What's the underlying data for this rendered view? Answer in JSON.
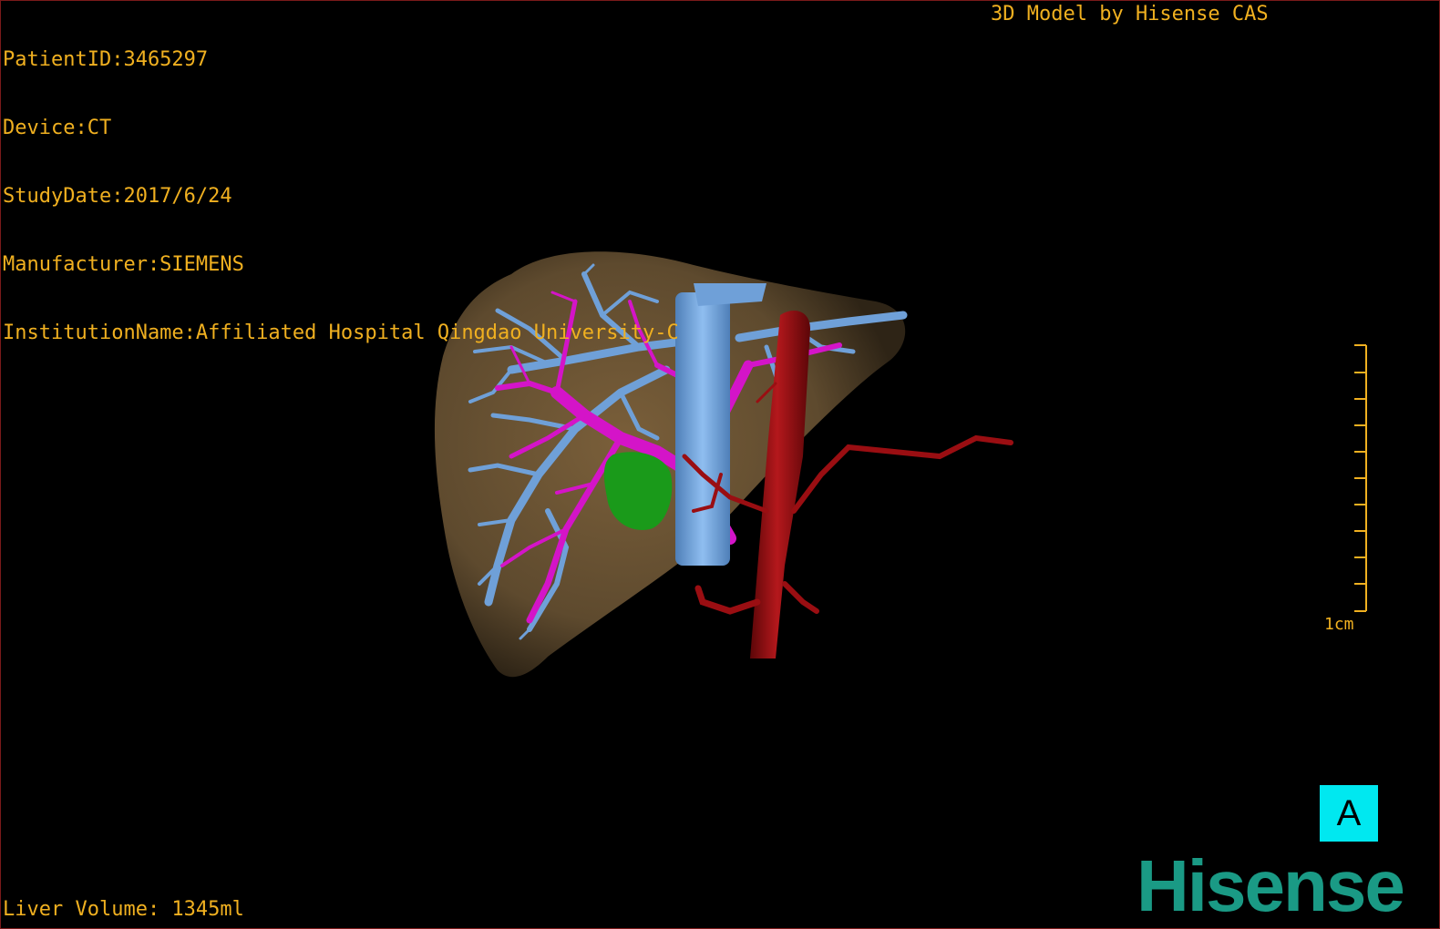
{
  "header": {
    "patient_id": "PatientID:3465297",
    "device": "Device:CT",
    "study_date": "StudyDate:2017/6/24",
    "manufacturer": "Manufacturer:SIEMENS",
    "institution": "InstitutionName:Affiliated Hospital Qingdao University-C",
    "model_credit": "3D Model by Hisense CAS"
  },
  "footer": {
    "liver_volume": "Liver Volume: 1345ml"
  },
  "scale_bar": {
    "label": "1cm"
  },
  "view_badge": {
    "label": "A"
  },
  "brand": {
    "logo_text": "Hisense"
  },
  "colors": {
    "overlay_text": "#f0b020",
    "liver": "#6e5534",
    "hepatic_vein": "#6fa0d8",
    "portal_vein": "#d414c8",
    "artery": "#9a0e12",
    "tumor": "#1a9a1a",
    "badge": "#00e8f0",
    "brand": "#1a9a85"
  }
}
